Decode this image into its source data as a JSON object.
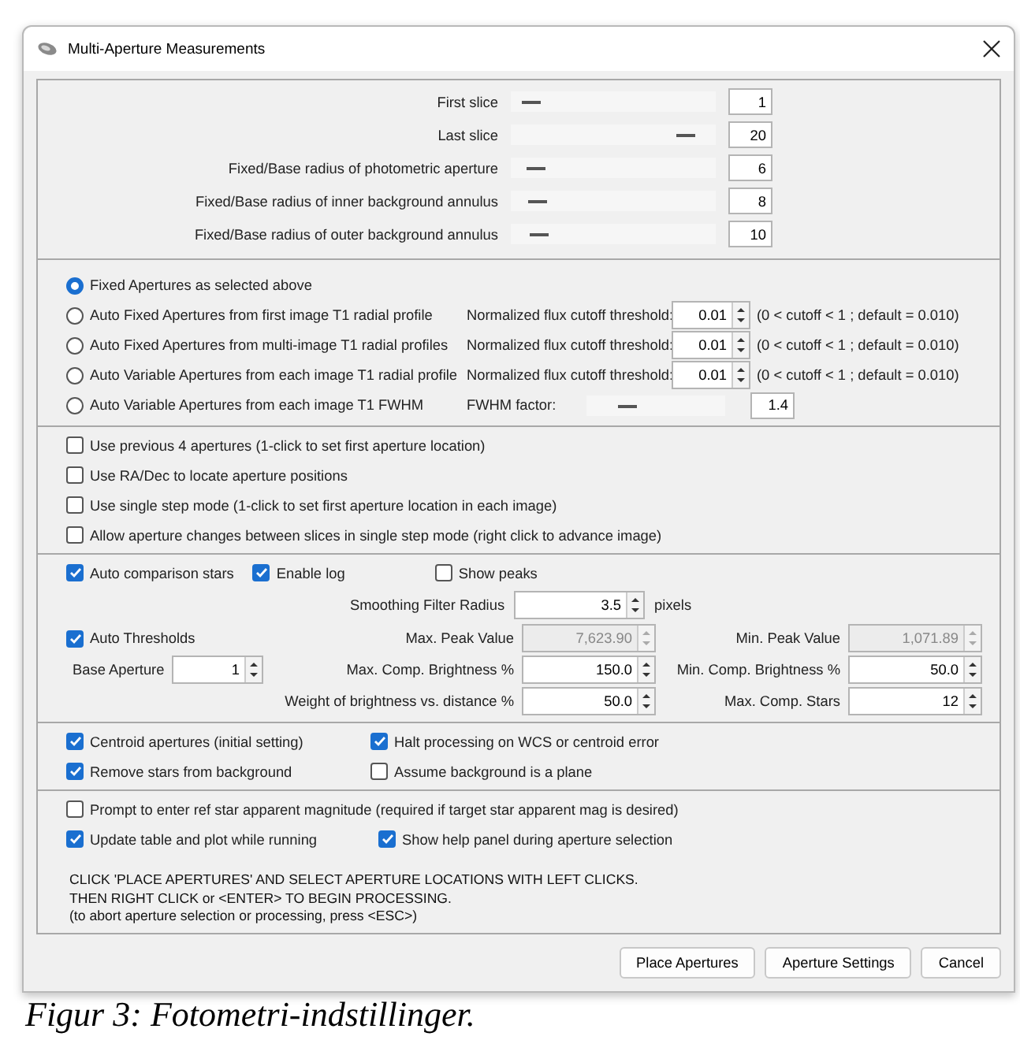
{
  "window": {
    "title": "Multi-Aperture Measurements"
  },
  "sliders": [
    {
      "label": "First slice",
      "value": "1",
      "level": 0.1
    },
    {
      "label": "Last slice",
      "value": "20",
      "level": 0.85
    },
    {
      "label": "Fixed/Base radius of photometric aperture",
      "value": "6",
      "level": 0.12
    },
    {
      "label": "Fixed/Base radius of inner background annulus",
      "value": "8",
      "level": 0.13
    },
    {
      "label": "Fixed/Base radius of outer background annulus",
      "value": "10",
      "level": 0.14
    }
  ],
  "aperture_modes": [
    {
      "kind": "plain",
      "label": "Fixed Apertures as selected above",
      "selected": true
    },
    {
      "kind": "threshold",
      "label": "Auto Fixed Apertures from first image T1 radial profile",
      "selected": false,
      "field_label": "Normalized flux cutoff threshold:",
      "value": "0.01",
      "note": "(0 < cutoff < 1 ; default = 0.010)"
    },
    {
      "kind": "threshold",
      "label": "Auto Fixed Apertures from multi-image T1 radial profiles",
      "selected": false,
      "field_label": "Normalized flux cutoff threshold:",
      "value": "0.01",
      "note": "(0 < cutoff < 1 ; default = 0.010)"
    },
    {
      "kind": "threshold",
      "label": "Auto Variable Apertures from each image T1 radial profile",
      "selected": false,
      "field_label": "Normalized flux cutoff threshold:",
      "value": "0.01",
      "note": "(0 < cutoff < 1 ; default = 0.010)"
    },
    {
      "kind": "fwhm",
      "label": "Auto Variable Apertures from each image T1 FWHM",
      "selected": false,
      "field_label": "FWHM factor:",
      "value": "1.4",
      "level": 0.3
    }
  ],
  "placement_options": [
    {
      "label": "Use previous 4 apertures (1-click to set first aperture location)",
      "checked": false
    },
    {
      "label": "Use RA/Dec to locate aperture positions",
      "checked": false
    },
    {
      "label": "Use single step mode (1-click to set first aperture location in each image)",
      "checked": false
    },
    {
      "label": "Allow aperture changes between slices in single step mode (right click to advance image)",
      "checked": false
    }
  ],
  "comparison": {
    "toggles": [
      {
        "label": "Auto comparison stars",
        "checked": true
      },
      {
        "label": "Enable log",
        "checked": true
      },
      {
        "label": "Show peaks",
        "checked": false
      }
    ],
    "smoothing": {
      "label": "Smoothing Filter Radius",
      "value": "3.5",
      "unit": "pixels"
    },
    "auto_thresholds": {
      "label": "Auto Thresholds",
      "checked": true
    },
    "base_aperture": {
      "label": "Base Aperture",
      "value": "1"
    },
    "fields": [
      {
        "label": "Max. Peak Value",
        "value": "7,623.90",
        "disabled": true
      },
      {
        "label": "Min. Peak Value",
        "value": "1,071.89",
        "disabled": true
      },
      {
        "label": "Max. Comp. Brightness %",
        "value": "150.0",
        "disabled": false
      },
      {
        "label": "Min. Comp. Brightness %",
        "value": "50.0",
        "disabled": false
      },
      {
        "label": "Weight of brightness vs. distance %",
        "value": "50.0",
        "disabled": false
      },
      {
        "label": "Max. Comp. Stars",
        "value": "12",
        "disabled": false
      }
    ]
  },
  "centroid_options": [
    {
      "label": "Centroid apertures (initial setting)",
      "checked": true
    },
    {
      "label": "Halt processing on WCS or centroid error",
      "checked": true
    },
    {
      "label": "Remove stars from background",
      "checked": true
    },
    {
      "label": "Assume background is a plane",
      "checked": false
    }
  ],
  "prompt_option": {
    "label": "Prompt to enter ref star apparent magnitude (required if target star apparent mag is desired)",
    "checked": false
  },
  "run_options": [
    {
      "label": "Update table and plot while running",
      "checked": true
    },
    {
      "label": "Show help panel during aperture selection",
      "checked": true
    }
  ],
  "instructions": [
    "CLICK 'PLACE APERTURES' AND SELECT APERTURE LOCATIONS WITH LEFT CLICKS.",
    "THEN RIGHT CLICK or <ENTER> TO BEGIN PROCESSING.",
    "(to abort aperture selection or processing, press <ESC>)"
  ],
  "buttons": [
    "Place Apertures",
    "Aperture Settings",
    "Cancel"
  ],
  "caption": "Figur 3: Fotometri-indstillinger."
}
